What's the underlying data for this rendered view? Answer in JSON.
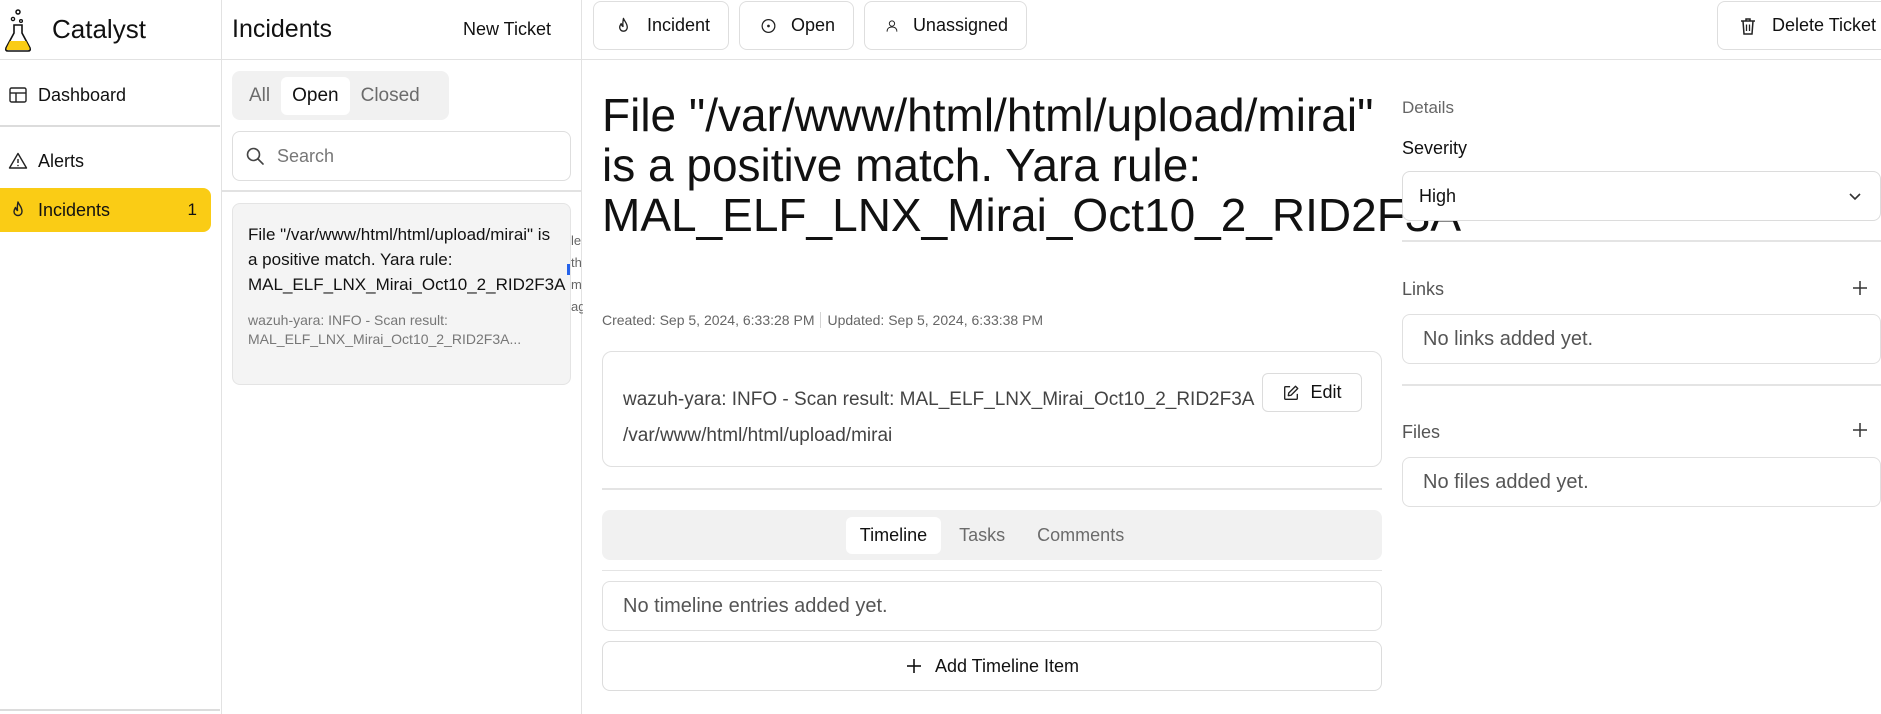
{
  "app": {
    "name": "Catalyst"
  },
  "nav": {
    "items": [
      {
        "label": "Dashboard",
        "icon": "dashboard-icon"
      },
      {
        "label": "Alerts",
        "icon": "alert-triangle-icon"
      },
      {
        "label": "Incidents",
        "icon": "flame-icon",
        "count": "1",
        "active": true
      }
    ]
  },
  "ticket_list": {
    "title": "Incidents",
    "new_ticket_label": "New Ticket",
    "filters": [
      "All",
      "Open",
      "Closed"
    ],
    "active_filter": "Open",
    "search_placeholder": "Search",
    "tickets": [
      {
        "title": "File \"/var/www/html/html/upload/mirai\" is a positive match. Yara rule: MAL_ELF_LNX_Mirai_Oct10_2_RID2F3A",
        "description": "wazuh-yara: INFO - Scan result: MAL_ELF_LNX_Mirai_Oct10_2_RID2F3A..."
      }
    ],
    "peek_text": "le th m ag"
  },
  "toolbar": {
    "type_label": "Incident",
    "status_label": "Open",
    "owner_label": "Unassigned",
    "delete_label": "Delete Ticket"
  },
  "ticket": {
    "title": "File \"/var/www/html/html/upload/mirai\" is a positive match. Yara rule: MAL_ELF_LNX_Mirai_Oct10_2_RID2F3A",
    "created": "Created: Sep 5, 2024, 6:33:28 PM",
    "updated": "Updated: Sep 5, 2024, 6:33:38 PM",
    "description": "wazuh-yara: INFO - Scan result: MAL_ELF_LNX_Mirai_Oct10_2_RID2F3A /var/www/html/html/upload/mirai",
    "edit_label": "Edit",
    "tabs": [
      "Timeline",
      "Tasks",
      "Comments"
    ],
    "active_tab": "Timeline",
    "timeline_empty": "No timeline entries added yet.",
    "add_timeline_label": "Add Timeline Item"
  },
  "details": {
    "section_label": "Details",
    "severity_label": "Severity",
    "severity_value": "High",
    "links_label": "Links",
    "links_empty": "No links added yet.",
    "files_label": "Files",
    "files_empty": "No files added yet."
  },
  "colors": {
    "accent": "#facc15",
    "border": "#e2e2e2",
    "muted_text": "#6b6b6b",
    "scroll_marker": "#2563eb"
  }
}
